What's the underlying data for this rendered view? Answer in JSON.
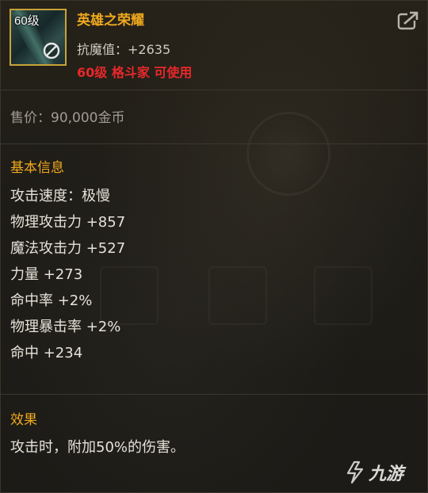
{
  "item": {
    "level_badge": "60级",
    "icon": "sword-icon",
    "status_icon": "forbidden-icon",
    "name": "英雄之荣耀",
    "stat_line": "抗魔值：+2635",
    "requirement": "60级 格斗家 可使用",
    "share_icon": "share-icon"
  },
  "sell_price": "售价：90,000金币",
  "basic_info": {
    "title": "基本信息",
    "attributes": [
      "攻击速度：极慢",
      "物理攻击力 +857",
      "魔法攻击力 +527",
      "力量 +273",
      "命中率 +2%",
      "物理暴击率 +2%",
      "命中 +234"
    ]
  },
  "effect": {
    "title": "效果",
    "text": "攻击时，附加50%的伤害。"
  },
  "watermark": {
    "text": "九游",
    "icon": "jiuyou-logo-icon"
  },
  "colors": {
    "title_gold": "#f0a81e",
    "requirement_red": "#e8282a",
    "text_light": "#e6e2d8",
    "text_muted": "#a19d92",
    "icon_border": "#c9a23a"
  }
}
